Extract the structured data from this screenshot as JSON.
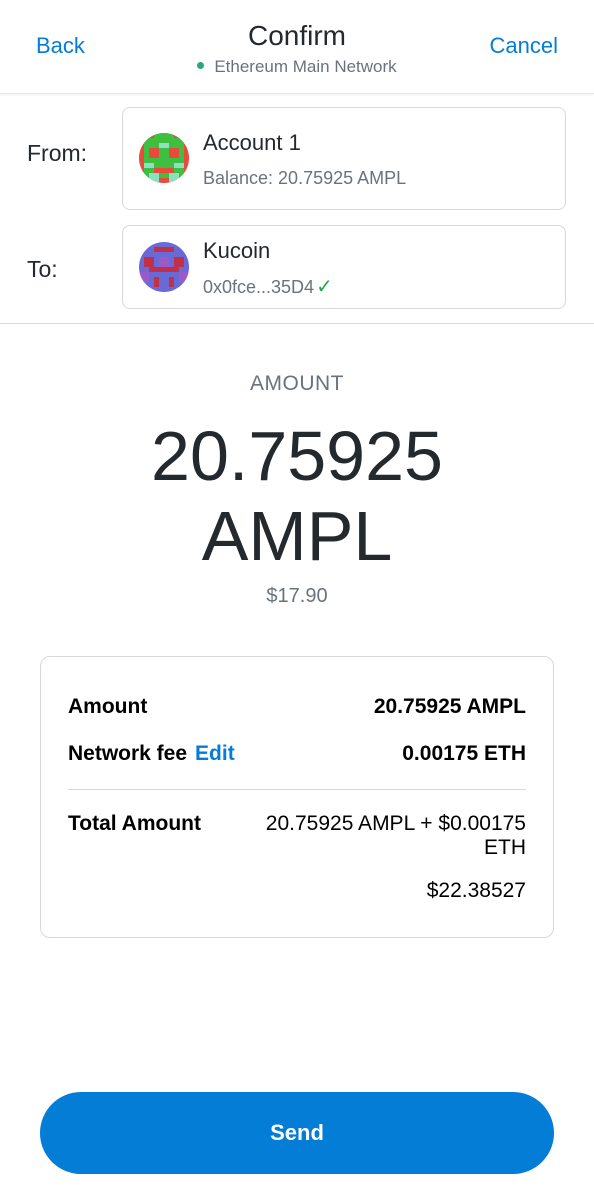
{
  "header": {
    "back_label": "Back",
    "title": "Confirm",
    "network": "Ethereum Main Network",
    "cancel_label": "Cancel"
  },
  "from": {
    "label": "From:",
    "account_name": "Account 1",
    "balance": "Balance: 20.75925 AMPL"
  },
  "to": {
    "label": "To:",
    "name": "Kucoin",
    "address": "0x0fce...35D4",
    "verified_icon": "check-icon"
  },
  "amount": {
    "label": "AMOUNT",
    "value_line1": "20.75925",
    "value_line2": "AMPL",
    "fiat": "$17.90"
  },
  "summary": {
    "amount_label": "Amount",
    "amount_value": "20.75925 AMPL",
    "fee_label": "Network fee",
    "edit_label": "Edit",
    "fee_value": "0.00175 ETH",
    "total_label": "Total Amount",
    "total_value": "20.75925 AMPL + $0.00175 ETH",
    "total_fiat": "$22.38527"
  },
  "send_label": "Send",
  "colors": {
    "accent": "#037dd6",
    "network_dot": "#28a77a",
    "verified": "#28a745"
  }
}
